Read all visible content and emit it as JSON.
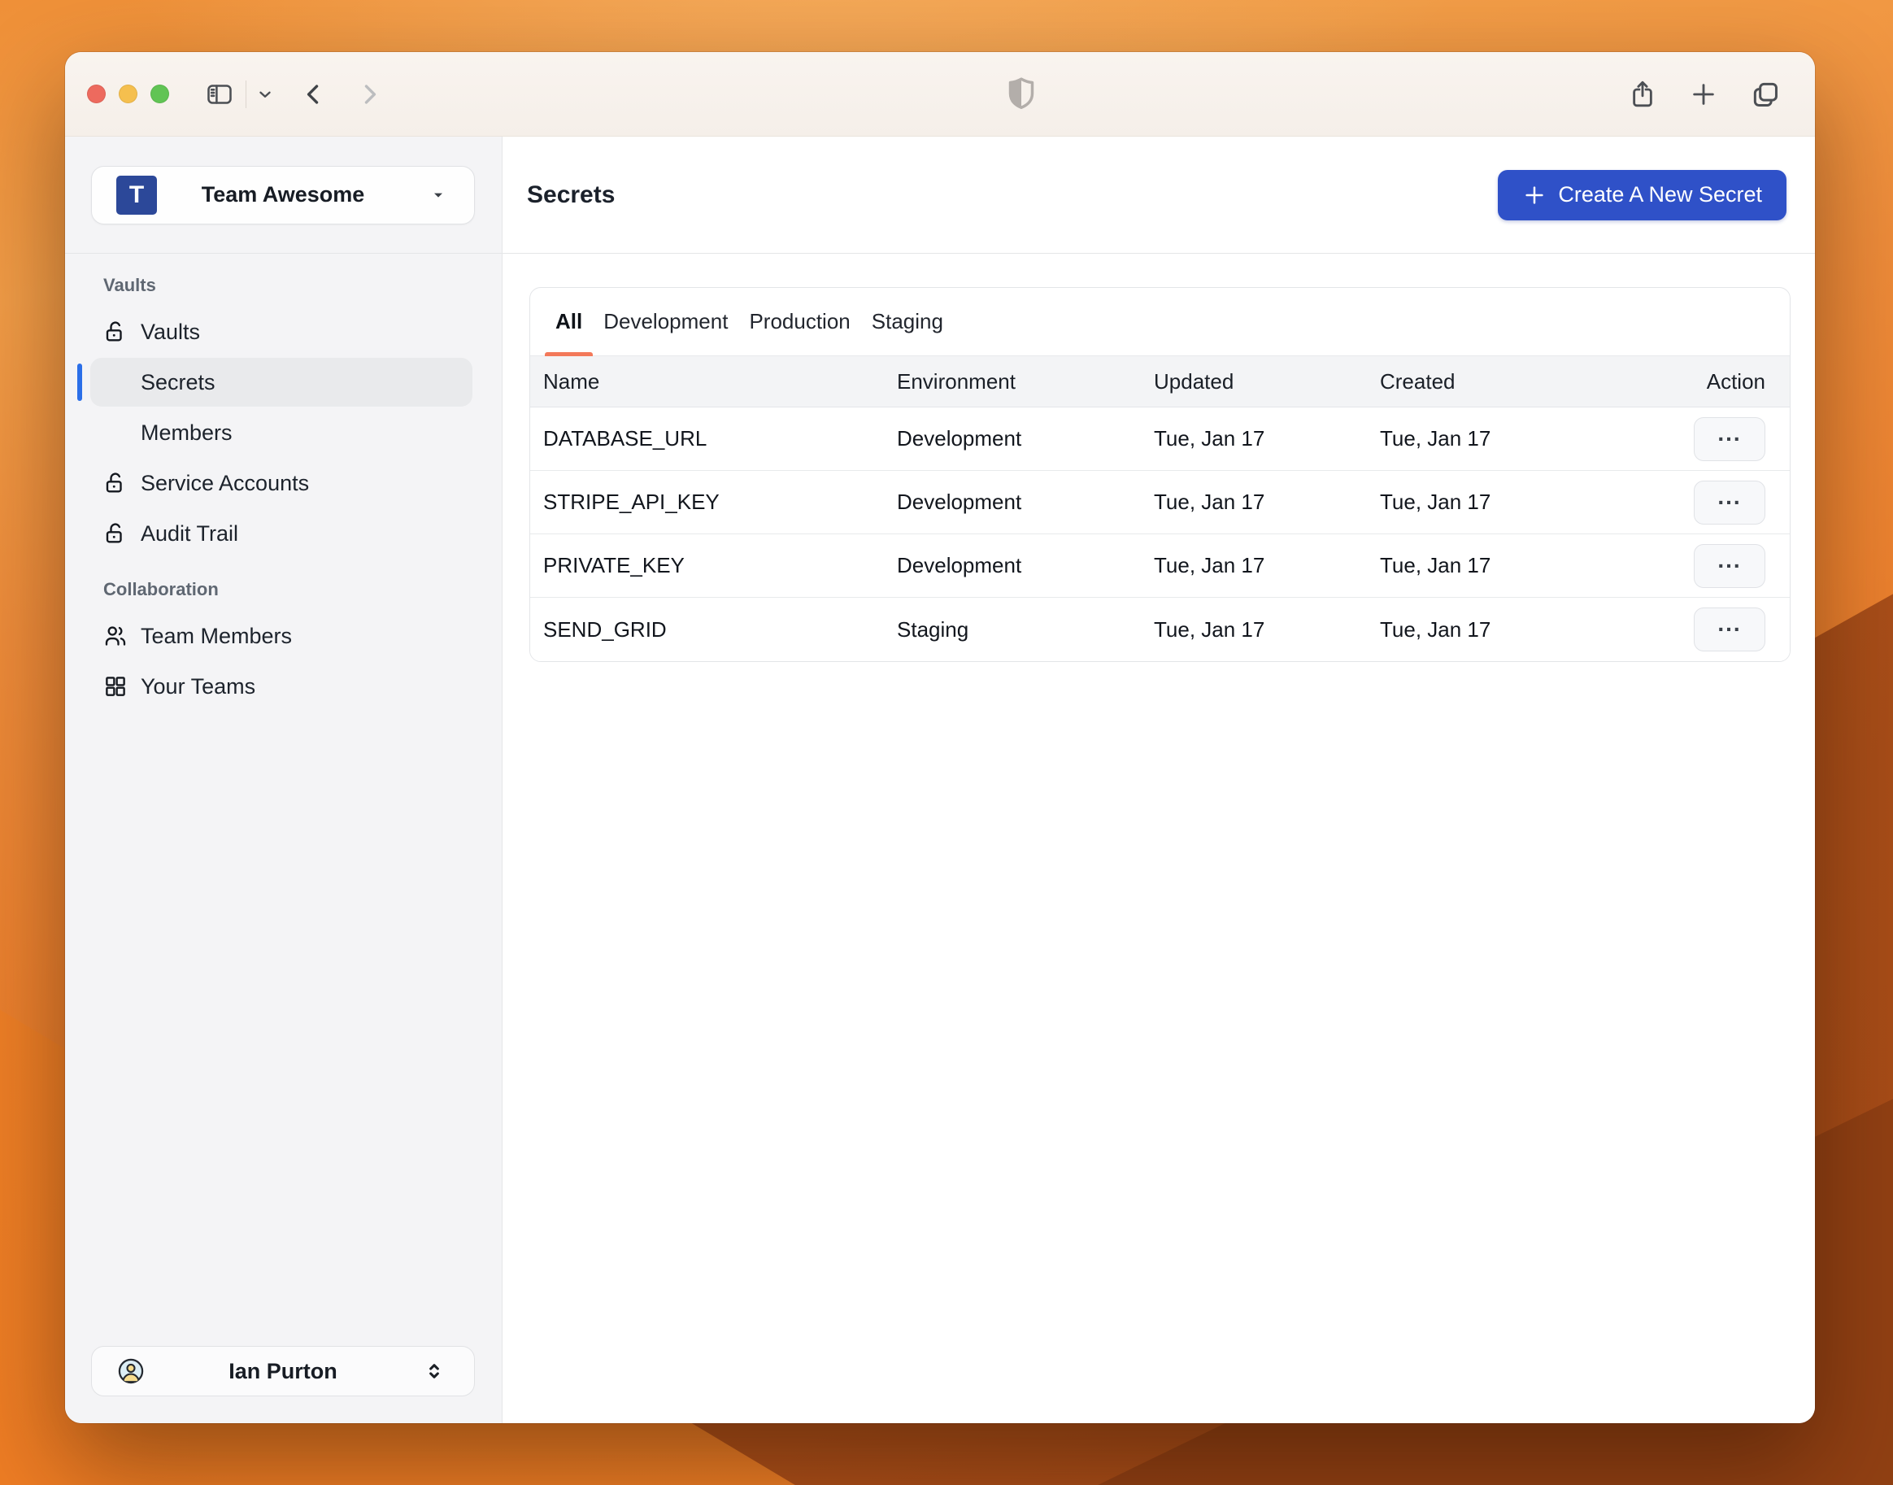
{
  "titlebar": {
    "window_controls": [
      "close",
      "minimize",
      "zoom"
    ],
    "icons": [
      "sidebar-toggle-icon",
      "chevron-down-icon",
      "back-icon",
      "forward-icon",
      "shield-icon",
      "share-icon",
      "new-tab-icon",
      "tab-overview-icon"
    ]
  },
  "sidebar": {
    "team": {
      "initial": "T",
      "name": "Team Awesome"
    },
    "sections": [
      {
        "label": "Vaults",
        "items": [
          {
            "label": "Vaults",
            "icon": "lock-open-icon"
          },
          {
            "label": "Secrets",
            "icon": null,
            "selected": true
          },
          {
            "label": "Members",
            "icon": null
          },
          {
            "label": "Service Accounts",
            "icon": "lock-open-icon"
          },
          {
            "label": "Audit Trail",
            "icon": "lock-open-icon"
          }
        ]
      },
      {
        "label": "Collaboration",
        "items": [
          {
            "label": "Team Members",
            "icon": "users-icon"
          },
          {
            "label": "Your Teams",
            "icon": "grid-icon"
          }
        ]
      }
    ],
    "user": {
      "name": "Ian Purton"
    }
  },
  "main": {
    "title": "Secrets",
    "create_button_label": "Create A New Secret",
    "tabs": [
      {
        "label": "All",
        "active": true
      },
      {
        "label": "Development",
        "active": false
      },
      {
        "label": "Production",
        "active": false
      },
      {
        "label": "Staging",
        "active": false
      }
    ],
    "table": {
      "columns": [
        "Name",
        "Environment",
        "Updated",
        "Created",
        "Action"
      ],
      "action_label": "...",
      "rows": [
        {
          "name": "DATABASE_URL",
          "environment": "Development",
          "updated": "Tue, Jan 17",
          "created": "Tue, Jan 17"
        },
        {
          "name": "STRIPE_API_KEY",
          "environment": "Development",
          "updated": "Tue, Jan 17",
          "created": "Tue, Jan 17"
        },
        {
          "name": "PRIVATE_KEY",
          "environment": "Development",
          "updated": "Tue, Jan 17",
          "created": "Tue, Jan 17"
        },
        {
          "name": "SEND_GRID",
          "environment": "Staging",
          "updated": "Tue, Jan 17",
          "created": "Tue, Jan 17"
        }
      ]
    }
  },
  "colors": {
    "accent_blue": "#2f51c8",
    "avatar_blue": "#2c4899",
    "selected_bar": "#2b6fe8",
    "tab_underline": "#f3795a",
    "traffic_red": "#ed6a5e",
    "traffic_yellow": "#f5bf4e",
    "traffic_green": "#61c454"
  }
}
